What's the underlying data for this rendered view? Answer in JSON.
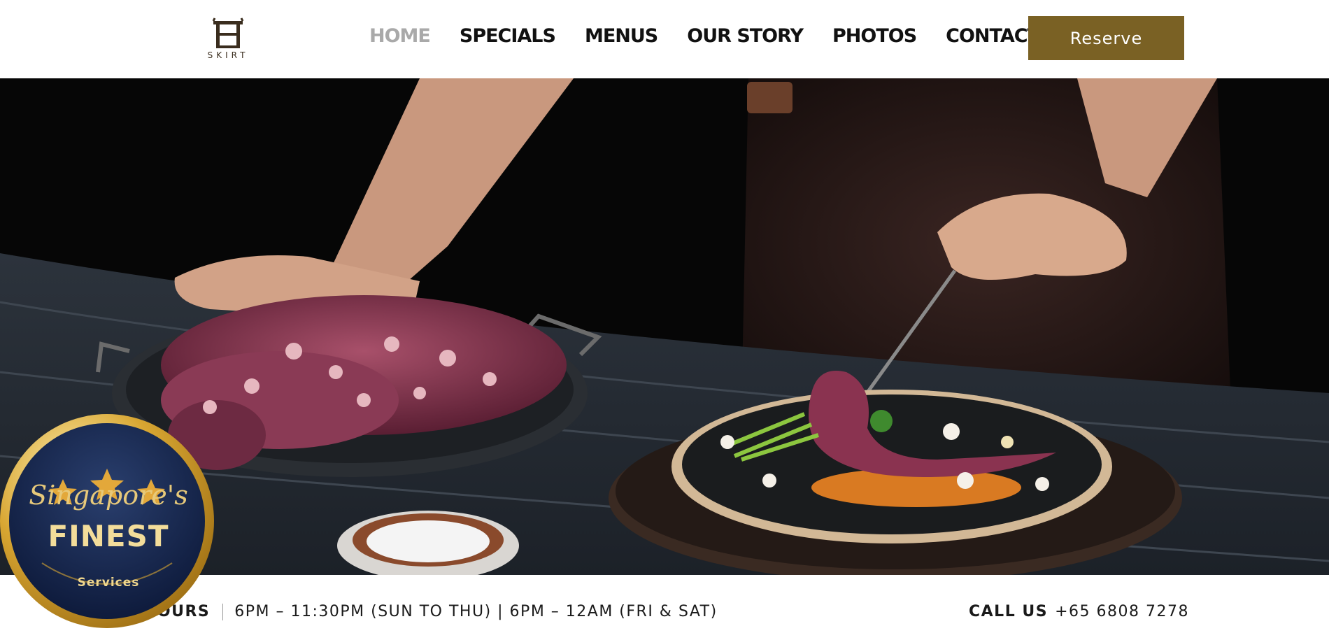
{
  "header": {
    "logo_text": "SKIRT",
    "nav": [
      {
        "label": "HOME",
        "active": true
      },
      {
        "label": "SPECIALS",
        "active": false
      },
      {
        "label": "MENUS",
        "active": false
      },
      {
        "label": "OUR STORY",
        "active": false
      },
      {
        "label": "PHOTOS",
        "active": false
      },
      {
        "label": "CONTACT",
        "active": false
      }
    ],
    "reserve_label": "Reserve"
  },
  "badge": {
    "script_text": "Singapore's",
    "main_text": "FINEST",
    "sub_text": "Services",
    "stars": 3
  },
  "info": {
    "hours_label": "HOURS",
    "hours_value": "6PM – 11:30PM (SUN TO THU) | 6PM – 12AM (FRI & SAT)",
    "call_label": "CALL US",
    "phone": "+65 6808 7278"
  },
  "colors": {
    "accent": "#7a6124",
    "nav_active": "#a9a9a9",
    "nav_default": "#111111"
  }
}
